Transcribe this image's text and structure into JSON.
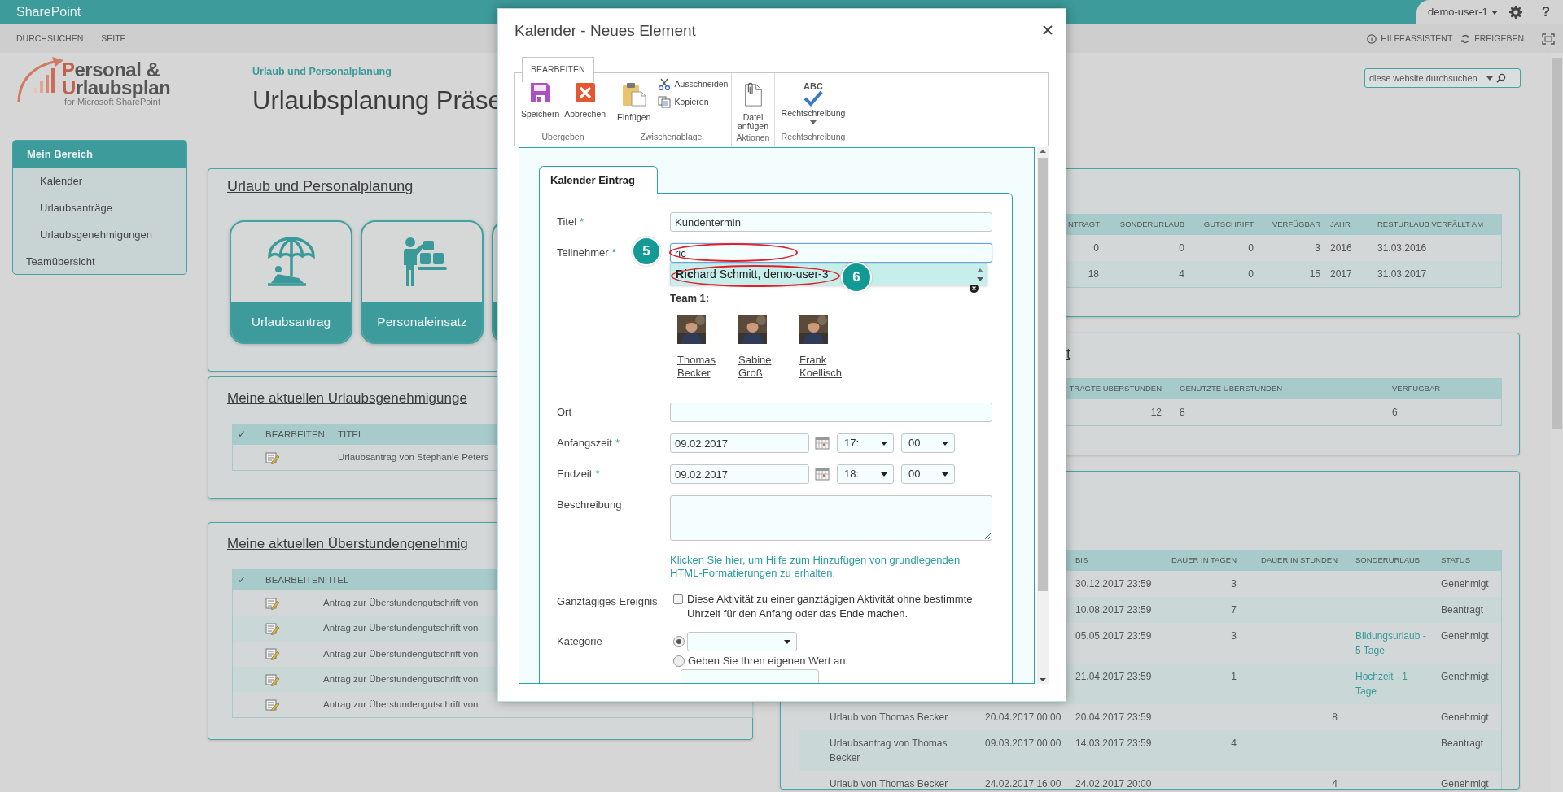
{
  "topbar": {
    "brand": "SharePoint",
    "user": "demo-user-1",
    "help": "?"
  },
  "subbar": {
    "tabs": [
      "DURCHSUCHEN",
      "SEITE"
    ],
    "actions": [
      "HILFEASSISTENT",
      "FREIGEBEN"
    ]
  },
  "logo": {
    "line1": "Personal &",
    "line2": "Urlaubsplan",
    "tagline": "for Microsoft SharePoint"
  },
  "breadcrumb": "Urlaub und Personalplanung",
  "page_title": "Urlaubsplanung Präse",
  "search": {
    "placeholder": "diese website durchsuchen"
  },
  "sidebar": {
    "items": [
      {
        "label": "Mein Bereich",
        "kind": "header",
        "children": [
          {
            "label": "Kalender"
          },
          {
            "label": "Urlaubsanträge"
          },
          {
            "label": "Urlaubsgenehmigungen"
          }
        ]
      },
      {
        "label": "Teamübersicht",
        "kind": "link"
      }
    ]
  },
  "left_panels": [
    {
      "title": "Urlaub und Personalplanung",
      "tiles": [
        {
          "label": "Urlaubsantrag"
        },
        {
          "label": "Personaleinsatz"
        }
      ]
    },
    {
      "title": "Meine aktuellen Urlaubsgenehmigunge",
      "table": {
        "columns": [
          {
            "label": "✓",
            "kind": "text"
          },
          {
            "label": "BEARBEITEN",
            "kind": "edit"
          },
          {
            "label": "TITEL",
            "kind": "text"
          }
        ],
        "rows": [
          {
            "column_3": "Urlaubsantrag von Stephanie Peters"
          }
        ]
      }
    },
    {
      "title": "Meine aktuellen Überstundengenehmig",
      "table": {
        "columns": [
          {
            "label": "✓",
            "kind": "text"
          },
          {
            "label": "BEARBEITEN",
            "kind": "edit"
          },
          {
            "label": "TITEL",
            "kind": "text"
          }
        ],
        "rows": [
          {
            "column_3": "Antrag zur Überstundengutschrift von"
          },
          {
            "column_3": "Antrag zur Überstundengutschrift von"
          },
          {
            "column_3": "Antrag zur Überstundengutschrift von"
          },
          {
            "column_3": "Antrag zur Überstundengutschrift von"
          },
          {
            "column_3": "Antrag zur Überstundengutschrift von"
          }
        ]
      }
    }
  ],
  "right_panels": [
    {
      "table": {
        "columns": [
          {
            "label": "NTRAGT",
            "kind": "text"
          },
          {
            "label": "SONDERURLAUB",
            "kind": "text"
          },
          {
            "label": "GUTSCHRIFT",
            "kind": "text"
          },
          {
            "label": "VERFÜGBAR",
            "kind": "text"
          },
          {
            "label": "JAHR",
            "kind": "text"
          },
          {
            "label": "RESTURLAUB VERFÄLLT AM",
            "kind": "text"
          }
        ],
        "rows": [
          {
            "column_1": "0",
            "column_2": "0",
            "column_3": "0",
            "column_4": "3",
            "column_5": "2016",
            "column_6": "31.03.2016"
          },
          {
            "column_1": "18",
            "column_2": "4",
            "column_3": "0",
            "column_4": "15",
            "column_5": "2017",
            "column_6": "31.03.2017"
          }
        ]
      }
    },
    {
      "title": "t",
      "table": {
        "columns": [
          {
            "label": "TRAGTE ÜBERSTUNDEN",
            "kind": "text"
          },
          {
            "label": "GENUTZTE ÜBERSTUNDEN",
            "kind": "text"
          },
          {
            "label": "VERFÜGBAR",
            "kind": "text"
          }
        ],
        "rows": [
          {
            "column_1": "12",
            "column_2": "8",
            "column_3": "6"
          }
        ]
      }
    },
    {
      "table": {
        "columns": [
          {
            "kind": "text"
          },
          {
            "kind": "text"
          },
          {
            "label": "BIS",
            "kind": "text"
          },
          {
            "label": "DAUER IN TAGEN",
            "kind": "text"
          },
          {
            "label": "DAUER IN STUNDEN",
            "kind": "text"
          },
          {
            "label": "SONDERURLAUB",
            "kind": "link"
          },
          {
            "label": "STATUS",
            "kind": "text"
          }
        ],
        "rows": [
          {
            "column_3": "30.12.2017 23:59",
            "column_4": "3",
            "column_7": "Genehmigt"
          },
          {
            "column_3": "10.08.2017 23:59",
            "column_4": "7",
            "column_7": "Beantragt"
          },
          {
            "column_3": "05.05.2017 23:59",
            "column_4": "3",
            "column_6": "Bildungsurlaub - 5 Tage",
            "column_7": "Genehmigt"
          },
          {
            "column_3": "21.04.2017 23:59",
            "column_4": "1",
            "column_6": "Hochzeit - 1 Tage",
            "column_7": "Genehmigt"
          },
          {
            "column_1": "Urlaub von Thomas Becker",
            "column_2": "20.04.2017 00:00",
            "column_3": "20.04.2017 23:59",
            "column_5": "8",
            "column_7": "Genehmigt"
          },
          {
            "column_1": "Urlaubsantrag von Thomas Becker",
            "column_2": "09.03.2017 00:00",
            "column_3": "14.03.2017 23:59",
            "column_4": "4",
            "column_7": "Beantragt"
          },
          {
            "column_1": "Urlaub von Thomas Becker",
            "column_2": "24.02.2017 16:00",
            "column_3": "24.02.2017 20:00",
            "column_5": "4",
            "column_7": "Genehmigt"
          }
        ]
      }
    }
  ],
  "dialog": {
    "title": "Kalender - Neues Element",
    "ribbon": {
      "tab": "BEARBEITEN",
      "groups": [
        {
          "label": "Übergeben",
          "buttons": [
            {
              "label": "Speichern"
            },
            {
              "label": "Abbrechen"
            }
          ]
        },
        {
          "label": "Zwischenablage",
          "buttons": [
            {
              "label": "Einfügen"
            },
            {
              "label": "Ausschneiden",
              "kind": "small"
            },
            {
              "label": "Kopieren",
              "kind": "small"
            }
          ]
        },
        {
          "label": "Aktionen",
          "buttons": [
            {
              "label": "Datei anfügen"
            }
          ]
        },
        {
          "label": "Rechtschreibung",
          "buttons": [
            {
              "label": "Rechtschreibung",
              "icon_text": "ABC",
              "dropdown": true
            }
          ]
        }
      ]
    },
    "form": {
      "tab": "Kalender Eintrag",
      "required_marker": "*",
      "fields": [
        {
          "kind": "text",
          "label": "Titel",
          "required": true,
          "value": "Kundentermin"
        },
        {
          "kind": "people",
          "label": "Teilnehmer",
          "required": true,
          "value": "ric",
          "focused": true,
          "suggestions": [
            "**Ric**hard Schmitt, demo-user-3"
          ],
          "group": "Team 1:",
          "members": [
            "Thomas Becker",
            "Sabine Groß",
            "Frank Koellisch"
          ]
        },
        {
          "kind": "text",
          "label": "Ort",
          "required": false
        },
        {
          "kind": "datetime",
          "label": "Anfangszeit",
          "required": true,
          "date": "09.02.2017",
          "hour": "17:",
          "minute": "00"
        },
        {
          "kind": "datetime",
          "label": "Endzeit",
          "required": true,
          "date": "09.02.2017",
          "hour": "18:",
          "minute": "00"
        },
        {
          "kind": "textarea",
          "label": "Beschreibung",
          "required": false,
          "help": "Klicken Sie hier, um Hilfe zum Hinzufügen von grundlegenden HTML-Formatierungen zu erhalten."
        },
        {
          "kind": "checkbox",
          "label": "Ganztägiges Ereignis",
          "checked": false,
          "text": "Diese Aktivität zu einer ganztägigen Aktivität ohne bestimmte Uhrzeit für den Anfang oder das Ende machen."
        },
        {
          "kind": "choice",
          "label": "Kategorie",
          "options": [
            {
              "kind": "dropdown",
              "selected": true
            },
            {
              "kind": "custom",
              "label": "Geben Sie Ihren eigenen Wert an:",
              "selected": false
            }
          ]
        }
      ]
    },
    "annotations": [
      {
        "label": "5"
      },
      {
        "label": "6"
      }
    ]
  }
}
